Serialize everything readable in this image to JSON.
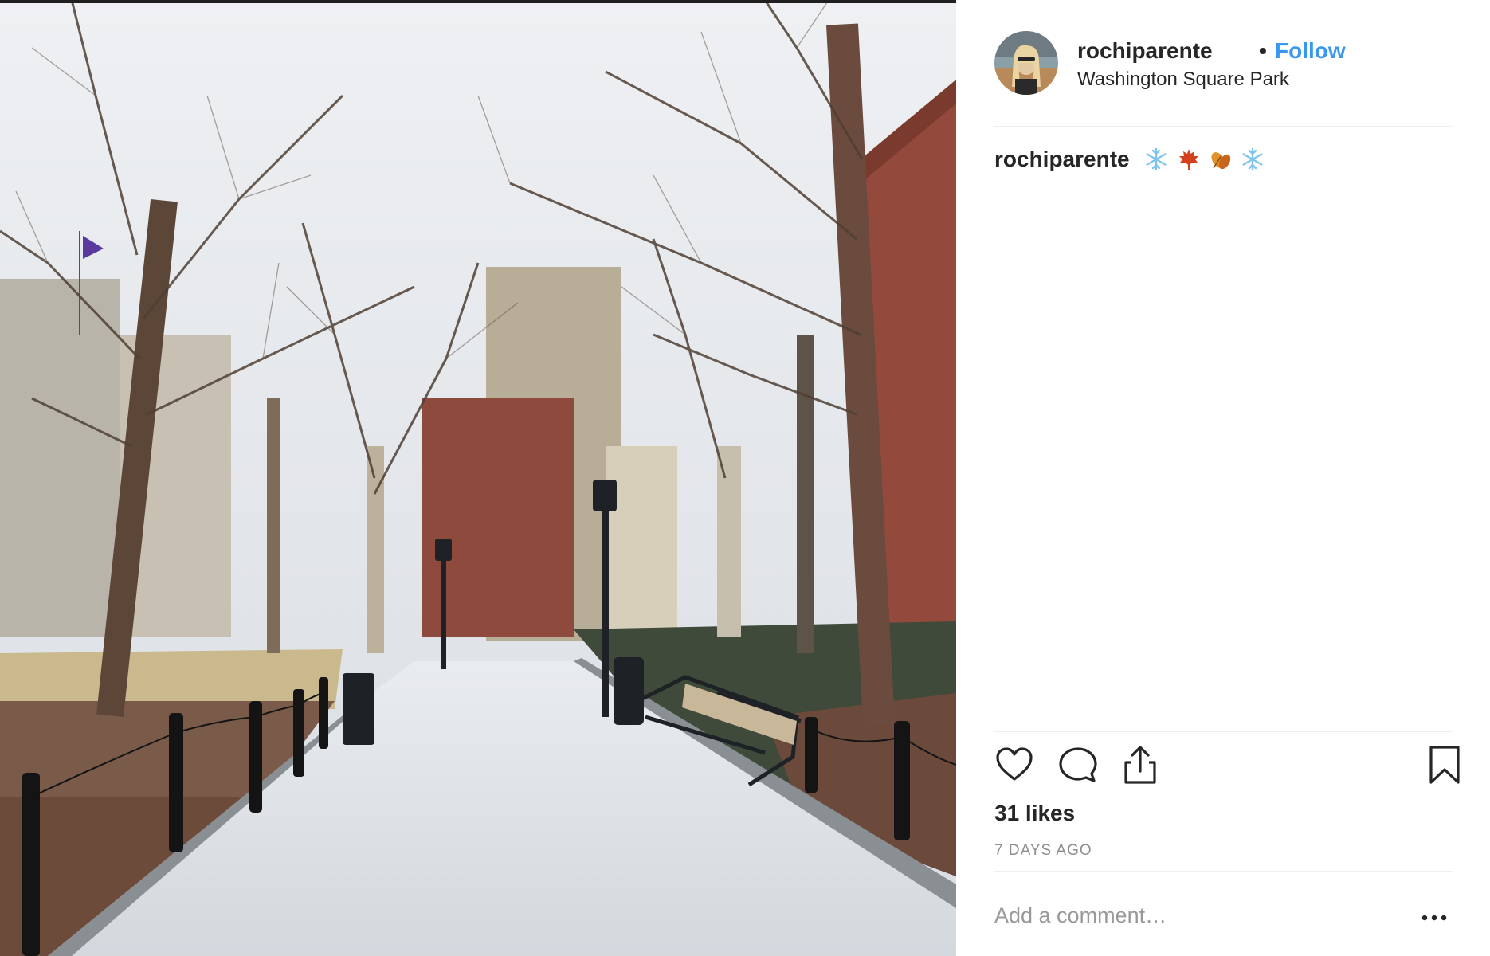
{
  "post": {
    "username": "rochiparente",
    "separator": "•",
    "follow_label": "Follow",
    "location": "Washington Square Park",
    "caption_username": "rochiparente",
    "caption_emojis": [
      "snowflake-emoji",
      "maple-leaf-emoji",
      "fallen-leaves-emoji",
      "snowflake-emoji"
    ],
    "likes": "31 likes",
    "time_ago": "7 DAYS AGO",
    "comment_placeholder": "Add a comment…"
  },
  "icons": {
    "like": "heart-icon",
    "comment": "comment-bubble-icon",
    "share": "share-icon",
    "save": "bookmark-icon",
    "more": "more-options-icon"
  },
  "colors": {
    "text": "#262626",
    "follow_accent": "#3897f0",
    "secondary_text": "#8e8e8e",
    "placeholder": "#999999",
    "divider": "#efefef"
  }
}
